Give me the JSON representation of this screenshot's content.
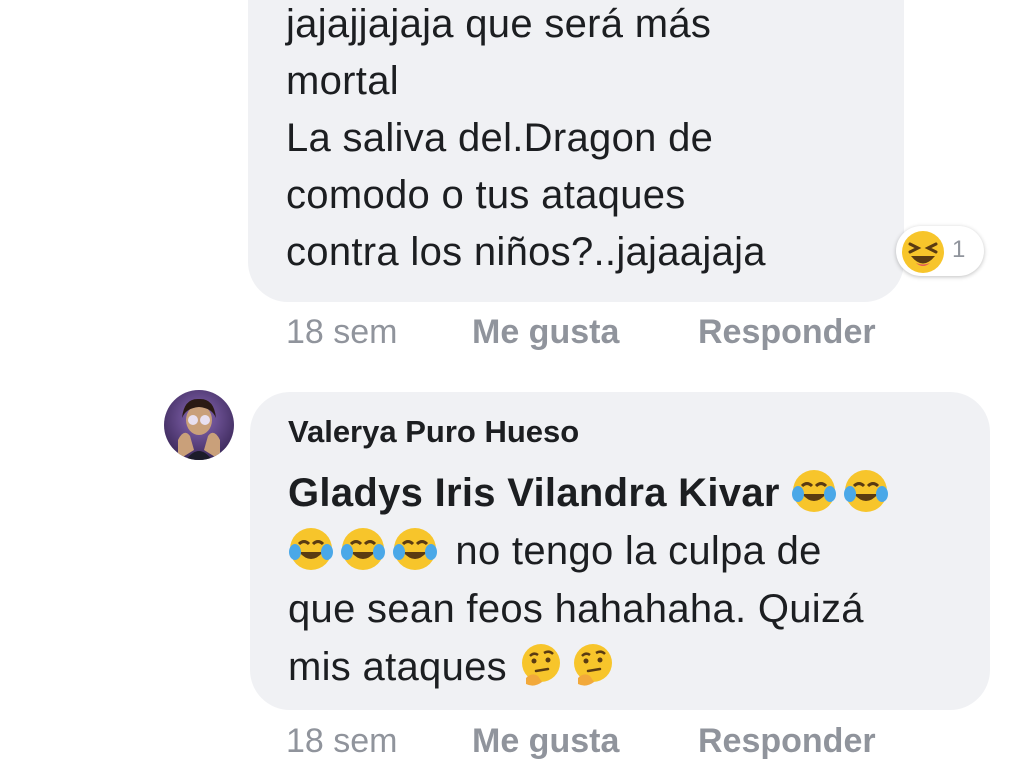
{
  "comment1": {
    "text": "jajajjajaja que será más\nmortal\nLa saliva del.Dragon de\ncomodo o tus ataques\ncontra los niños?..jajaajaja",
    "reaction": {
      "icon": "laughing-squint-emoji-icon",
      "count": "1"
    },
    "actions": {
      "time": "18 sem",
      "like": "Me gusta",
      "reply": "Responder"
    }
  },
  "comment2": {
    "author": "Valerya Puro Hueso",
    "avatar_icon": "user-avatar",
    "mention": "Gladys Iris Vilandra Kivar",
    "text_line1": " no tengo la culpa de",
    "text_rest": "que sean feos hahahaha. Quizá\nmis ataques ",
    "emojis": {
      "after_mention": [
        "face-with-tears-of-joy-icon",
        "face-with-tears-of-joy-icon"
      ],
      "line2_start": [
        "face-with-tears-of-joy-icon",
        "face-with-tears-of-joy-icon",
        "face-with-tears-of-joy-icon"
      ],
      "end": [
        "thinking-face-icon",
        "thinking-face-icon"
      ]
    },
    "actions": {
      "time": "18 sem",
      "like": "Me gusta",
      "reply": "Responder"
    }
  }
}
